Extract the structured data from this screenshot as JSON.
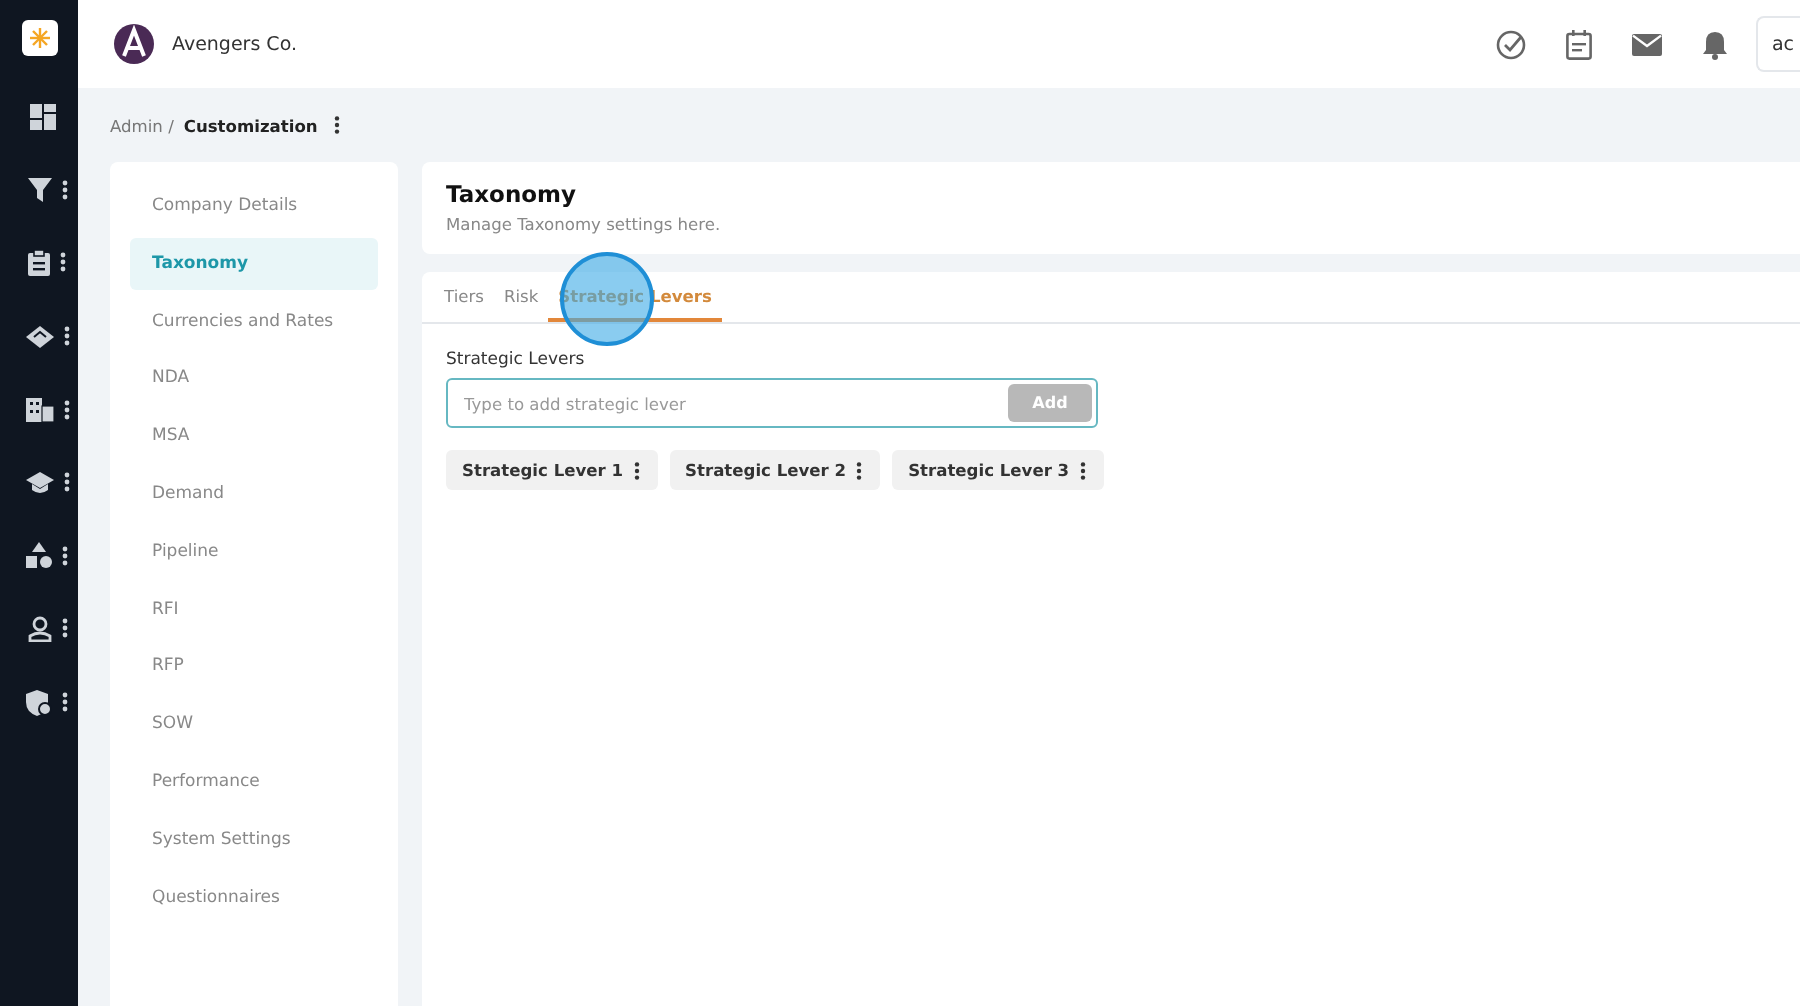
{
  "rail": {
    "items": [
      {
        "menu": false
      },
      {
        "menu": true
      },
      {
        "menu": true
      },
      {
        "menu": true
      },
      {
        "menu": true
      },
      {
        "menu": true
      },
      {
        "menu": true
      },
      {
        "menu": true
      },
      {
        "menu": true
      }
    ]
  },
  "header": {
    "company": "Avengers Co.",
    "account": "ac"
  },
  "breadcrumb": {
    "items": [
      "Admin /",
      "Customization"
    ]
  },
  "settings_nav": {
    "items": [
      {
        "label": "Company Details",
        "selected": false
      },
      {
        "label": "Taxonomy",
        "selected": true
      },
      {
        "label": "Currencies and Rates",
        "selected": false
      },
      {
        "label": "NDA",
        "selected": false
      },
      {
        "label": "MSA",
        "selected": false
      },
      {
        "label": "Demand",
        "selected": false
      },
      {
        "label": "Pipeline",
        "selected": false
      },
      {
        "label": "RFI",
        "selected": false
      },
      {
        "label": "RFP",
        "selected": false
      },
      {
        "label": "SOW",
        "selected": false
      },
      {
        "label": "Performance",
        "selected": false
      },
      {
        "label": "System Settings",
        "selected": false
      },
      {
        "label": "Questionnaires",
        "selected": false
      }
    ]
  },
  "page": {
    "title": "Taxonomy",
    "subtitle": "Manage Taxonomy settings here."
  },
  "tabs": [
    {
      "label": "Tiers",
      "selected": false
    },
    {
      "label": "Risk",
      "selected": false
    },
    {
      "label": "Strategic Levers",
      "selected": true
    }
  ],
  "levers": {
    "label": "Strategic Levers",
    "placeholder": "Type to add strategic lever",
    "add_button": {
      "label": "Add",
      "disabled": true
    },
    "chips": [
      "Strategic Lever 1",
      "Strategic Lever 2",
      "Strategic Lever 3"
    ]
  },
  "click_indicator": true
}
